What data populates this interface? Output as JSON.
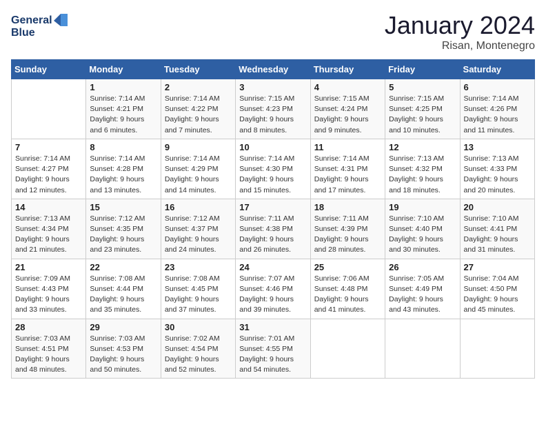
{
  "header": {
    "logo_line1": "General",
    "logo_line2": "Blue",
    "month": "January 2024",
    "location": "Risan, Montenegro"
  },
  "weekdays": [
    "Sunday",
    "Monday",
    "Tuesday",
    "Wednesday",
    "Thursday",
    "Friday",
    "Saturday"
  ],
  "weeks": [
    [
      {
        "day": "",
        "sunrise": "",
        "sunset": "",
        "daylight": ""
      },
      {
        "day": "1",
        "sunrise": "7:14 AM",
        "sunset": "4:21 PM",
        "daylight": "9 hours and 6 minutes."
      },
      {
        "day": "2",
        "sunrise": "7:14 AM",
        "sunset": "4:22 PM",
        "daylight": "9 hours and 7 minutes."
      },
      {
        "day": "3",
        "sunrise": "7:15 AM",
        "sunset": "4:23 PM",
        "daylight": "9 hours and 8 minutes."
      },
      {
        "day": "4",
        "sunrise": "7:15 AM",
        "sunset": "4:24 PM",
        "daylight": "9 hours and 9 minutes."
      },
      {
        "day": "5",
        "sunrise": "7:15 AM",
        "sunset": "4:25 PM",
        "daylight": "9 hours and 10 minutes."
      },
      {
        "day": "6",
        "sunrise": "7:14 AM",
        "sunset": "4:26 PM",
        "daylight": "9 hours and 11 minutes."
      }
    ],
    [
      {
        "day": "7",
        "sunrise": "7:14 AM",
        "sunset": "4:27 PM",
        "daylight": "9 hours and 12 minutes."
      },
      {
        "day": "8",
        "sunrise": "7:14 AM",
        "sunset": "4:28 PM",
        "daylight": "9 hours and 13 minutes."
      },
      {
        "day": "9",
        "sunrise": "7:14 AM",
        "sunset": "4:29 PM",
        "daylight": "9 hours and 14 minutes."
      },
      {
        "day": "10",
        "sunrise": "7:14 AM",
        "sunset": "4:30 PM",
        "daylight": "9 hours and 15 minutes."
      },
      {
        "day": "11",
        "sunrise": "7:14 AM",
        "sunset": "4:31 PM",
        "daylight": "9 hours and 17 minutes."
      },
      {
        "day": "12",
        "sunrise": "7:13 AM",
        "sunset": "4:32 PM",
        "daylight": "9 hours and 18 minutes."
      },
      {
        "day": "13",
        "sunrise": "7:13 AM",
        "sunset": "4:33 PM",
        "daylight": "9 hours and 20 minutes."
      }
    ],
    [
      {
        "day": "14",
        "sunrise": "7:13 AM",
        "sunset": "4:34 PM",
        "daylight": "9 hours and 21 minutes."
      },
      {
        "day": "15",
        "sunrise": "7:12 AM",
        "sunset": "4:35 PM",
        "daylight": "9 hours and 23 minutes."
      },
      {
        "day": "16",
        "sunrise": "7:12 AM",
        "sunset": "4:37 PM",
        "daylight": "9 hours and 24 minutes."
      },
      {
        "day": "17",
        "sunrise": "7:11 AM",
        "sunset": "4:38 PM",
        "daylight": "9 hours and 26 minutes."
      },
      {
        "day": "18",
        "sunrise": "7:11 AM",
        "sunset": "4:39 PM",
        "daylight": "9 hours and 28 minutes."
      },
      {
        "day": "19",
        "sunrise": "7:10 AM",
        "sunset": "4:40 PM",
        "daylight": "9 hours and 30 minutes."
      },
      {
        "day": "20",
        "sunrise": "7:10 AM",
        "sunset": "4:41 PM",
        "daylight": "9 hours and 31 minutes."
      }
    ],
    [
      {
        "day": "21",
        "sunrise": "7:09 AM",
        "sunset": "4:43 PM",
        "daylight": "9 hours and 33 minutes."
      },
      {
        "day": "22",
        "sunrise": "7:08 AM",
        "sunset": "4:44 PM",
        "daylight": "9 hours and 35 minutes."
      },
      {
        "day": "23",
        "sunrise": "7:08 AM",
        "sunset": "4:45 PM",
        "daylight": "9 hours and 37 minutes."
      },
      {
        "day": "24",
        "sunrise": "7:07 AM",
        "sunset": "4:46 PM",
        "daylight": "9 hours and 39 minutes."
      },
      {
        "day": "25",
        "sunrise": "7:06 AM",
        "sunset": "4:48 PM",
        "daylight": "9 hours and 41 minutes."
      },
      {
        "day": "26",
        "sunrise": "7:05 AM",
        "sunset": "4:49 PM",
        "daylight": "9 hours and 43 minutes."
      },
      {
        "day": "27",
        "sunrise": "7:04 AM",
        "sunset": "4:50 PM",
        "daylight": "9 hours and 45 minutes."
      }
    ],
    [
      {
        "day": "28",
        "sunrise": "7:03 AM",
        "sunset": "4:51 PM",
        "daylight": "9 hours and 48 minutes."
      },
      {
        "day": "29",
        "sunrise": "7:03 AM",
        "sunset": "4:53 PM",
        "daylight": "9 hours and 50 minutes."
      },
      {
        "day": "30",
        "sunrise": "7:02 AM",
        "sunset": "4:54 PM",
        "daylight": "9 hours and 52 minutes."
      },
      {
        "day": "31",
        "sunrise": "7:01 AM",
        "sunset": "4:55 PM",
        "daylight": "9 hours and 54 minutes."
      },
      {
        "day": "",
        "sunrise": "",
        "sunset": "",
        "daylight": ""
      },
      {
        "day": "",
        "sunrise": "",
        "sunset": "",
        "daylight": ""
      },
      {
        "day": "",
        "sunrise": "",
        "sunset": "",
        "daylight": ""
      }
    ]
  ]
}
